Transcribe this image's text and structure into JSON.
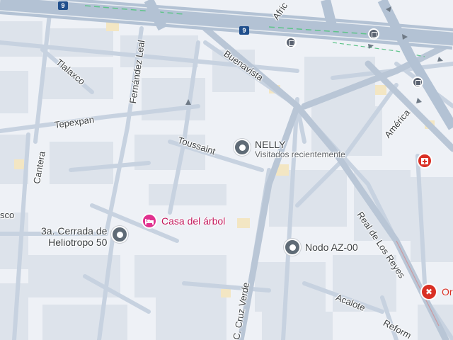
{
  "colors": {
    "background": "#eef1f6",
    "road": "#c7d2e0",
    "block": "#dde3eb",
    "highway": "#b3c2d4",
    "highway_lane": "#5fc48a",
    "highway_badge": "#1f4e8c",
    "pin_gray": "#5f6b76",
    "pin_pink": "#e0318f",
    "pin_red": "#d93025",
    "poi_label_pink": "#c2185b",
    "sand_block": "#f3e6c3"
  },
  "highway": {
    "badge": "9"
  },
  "streets": [
    {
      "id": "tlalaxco",
      "name": "Tlalaxco"
    },
    {
      "id": "fernandez-leal",
      "name": "Fernández Leal"
    },
    {
      "id": "tepexpan",
      "name": "Tepexpan"
    },
    {
      "id": "cantera",
      "name": "Cantera"
    },
    {
      "id": "buenavista",
      "name": "Buenavista"
    },
    {
      "id": "toussaint",
      "name": "Toussaint"
    },
    {
      "id": "america",
      "name": "América"
    },
    {
      "id": "real-de-los-reyes",
      "name": "Real de Los Reyes"
    },
    {
      "id": "acalote",
      "name": "Acalote"
    },
    {
      "id": "reforma",
      "name": "Reform"
    },
    {
      "id": "cruz-verde",
      "name": "C. Cruz Verde"
    },
    {
      "id": "africa",
      "name": "Afric"
    },
    {
      "id": "sco",
      "name": "sco"
    }
  ],
  "pois": [
    {
      "id": "nelly",
      "name": "NELLY",
      "subtitle": "Visitados recientemente",
      "icon": "history-pin-icon"
    },
    {
      "id": "cerrada",
      "name": "3a. Cerrada de Heliotropo 50",
      "line1": "3a. Cerrada de",
      "line2": "Heliotropo 50",
      "icon": "history-pin-icon"
    },
    {
      "id": "casa-arbol",
      "name": "Casa del árbol",
      "icon": "hotel-icon"
    },
    {
      "id": "nodo",
      "name": "Nodo AZ-00",
      "icon": "history-pin-icon"
    },
    {
      "id": "or",
      "name": "Or",
      "icon": "restaurant-icon"
    },
    {
      "id": "hospital",
      "icon": "hospital-icon"
    }
  ]
}
